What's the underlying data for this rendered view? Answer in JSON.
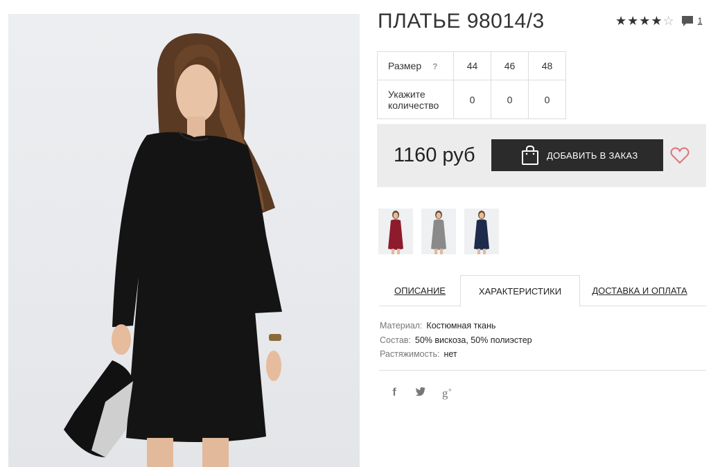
{
  "product": {
    "title": "ПЛАТЬЕ 98014/3",
    "rating": 4,
    "rating_max": 5,
    "comment_count": "1"
  },
  "sizes": {
    "size_label": "Размер",
    "help_mark": "?",
    "quantity_label": "Укажите количество",
    "options": [
      {
        "size": "44",
        "quantity": "0"
      },
      {
        "size": "46",
        "quantity": "0"
      },
      {
        "size": "48",
        "quantity": "0"
      }
    ]
  },
  "purchase": {
    "price": "1160 руб",
    "add_button_label": "ДОБАВИТЬ В ЗАКАЗ",
    "wishlist_icon": "heart-icon",
    "heart_color": "#e0707a"
  },
  "thumbnails": [
    {
      "color_name": "burgundy",
      "dress_color": "#8e1b2c"
    },
    {
      "color_name": "grey",
      "dress_color": "#8a8a8a"
    },
    {
      "color_name": "navy",
      "dress_color": "#1e2b4a"
    }
  ],
  "tabs": [
    {
      "label": "ОПИСАНИЕ",
      "active": false
    },
    {
      "label": "ХАРАКТЕРИСТИКИ",
      "active": true
    },
    {
      "label": "ДОСТАВКА И ОПЛАТА",
      "active": false
    }
  ],
  "characteristics": [
    {
      "key": "Материал:",
      "value": "Костюмная ткань"
    },
    {
      "key": "Состав:",
      "value": "50% вискоза, 50% полиэстер"
    },
    {
      "key": "Растяжимость:",
      "value": "нет"
    }
  ],
  "social": [
    {
      "icon": "facebook-icon",
      "glyph": "f"
    },
    {
      "icon": "twitter-icon",
      "glyph": "t"
    },
    {
      "icon": "google-plus-icon",
      "glyph": "g+"
    }
  ],
  "colors": {
    "dark_button": "#2b2b2b",
    "price_bar": "#ececec",
    "dress_main": "#141414"
  }
}
